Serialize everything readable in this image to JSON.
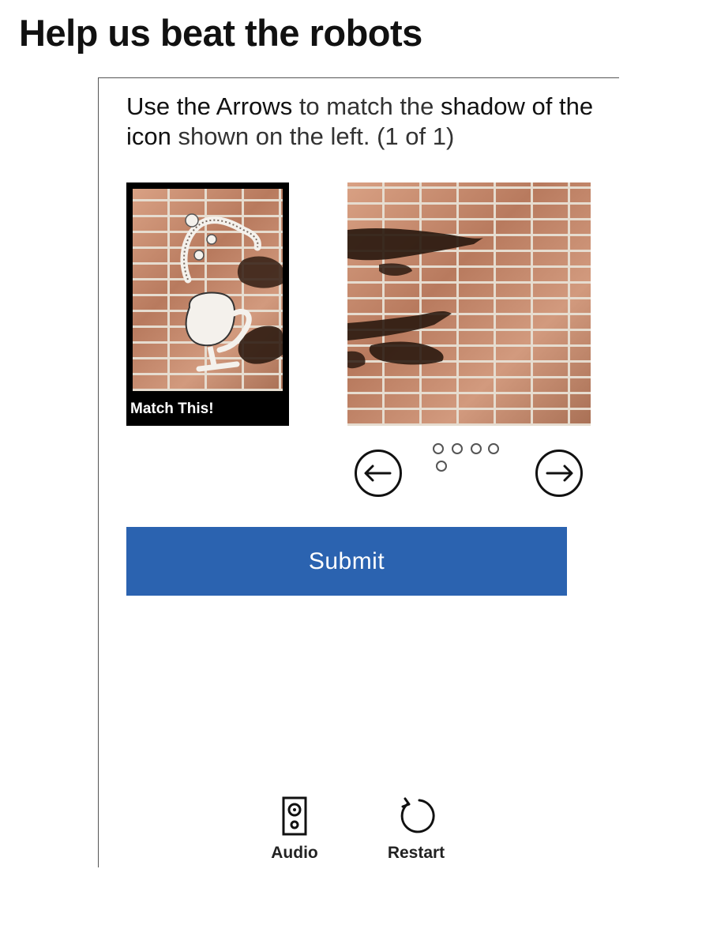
{
  "page": {
    "title": "Help us beat the robots"
  },
  "instruction": {
    "part1": "Use the Arrows",
    "part2": " to match the ",
    "part3": "shadow of the icon",
    "part4": " shown on the left. (1 of 1)"
  },
  "reference": {
    "label": "Match This!"
  },
  "pager": {
    "total": 5,
    "current": 1
  },
  "submit": {
    "label": "Submit"
  },
  "utilities": {
    "audio_label": "Audio",
    "restart_label": "Restart"
  },
  "colors": {
    "submit_bg": "#2b63b0",
    "reference_frame": "#000000",
    "brick": "#c98f72"
  },
  "icons": {
    "prev": "arrow-left-circle-icon",
    "next": "arrow-right-circle-icon",
    "audio": "speaker-icon",
    "restart": "refresh-icon"
  }
}
